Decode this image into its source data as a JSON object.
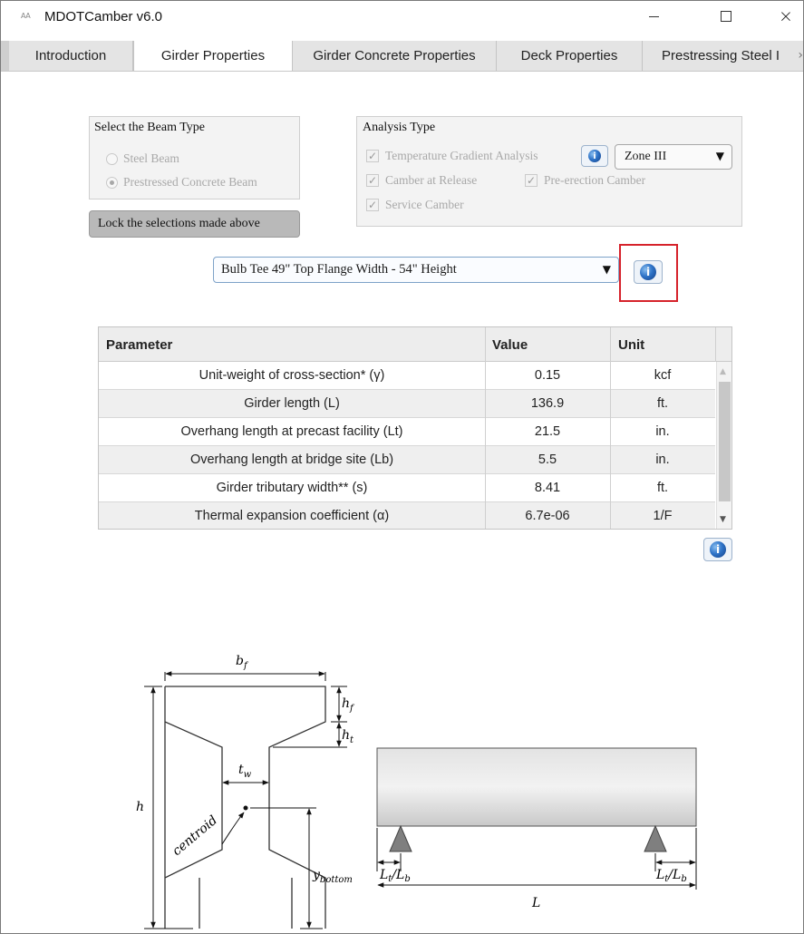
{
  "window": {
    "icon_text": "AA",
    "title": "MDOTCamber v6.0",
    "controls": {
      "minimize": "",
      "maximize": "",
      "close": "×"
    }
  },
  "tabs": [
    {
      "label": "Introduction",
      "active": false
    },
    {
      "label": "Girder Properties",
      "active": true
    },
    {
      "label": "Girder Concrete Properties",
      "active": false
    },
    {
      "label": "Deck Properties",
      "active": false
    },
    {
      "label": "Prestressing Steel I",
      "active": false
    }
  ],
  "beam_type": {
    "title": "Select the Beam Type",
    "options": [
      {
        "label": "Steel Beam",
        "selected": false
      },
      {
        "label": "Prestressed Concrete Beam",
        "selected": true
      }
    ]
  },
  "analysis_type": {
    "title": "Analysis Type",
    "temperature_gradient": {
      "label": "Temperature Gradient Analysis",
      "checked": true
    },
    "zone": {
      "value": "Zone III"
    },
    "camber_at_release": {
      "label": "Camber at Release",
      "checked": true
    },
    "pre_erection": {
      "label": "Pre-erection Camber",
      "checked": true
    },
    "service": {
      "label": "Service Camber",
      "checked": true
    }
  },
  "lock_button": {
    "label": "Lock the selections made above"
  },
  "girder_section": {
    "value": "Bulb Tee 49\" Top Flange Width - 54\" Height"
  },
  "table": {
    "headers": {
      "parameter": "Parameter",
      "value": "Value",
      "unit": "Unit"
    },
    "rows": [
      {
        "parameter": "Unit-weight of cross-section* (γ)",
        "value": "0.15",
        "unit": "kcf"
      },
      {
        "parameter": "Girder length (L)",
        "value": "136.9",
        "unit": "ft."
      },
      {
        "parameter": "Overhang length at precast facility (Lt)",
        "value": "21.5",
        "unit": "in."
      },
      {
        "parameter": "Overhang length at bridge site (Lb)",
        "value": "5.5",
        "unit": "in."
      },
      {
        "parameter": "Girder tributary width** (s)",
        "value": "8.41",
        "unit": "ft."
      },
      {
        "parameter": "Thermal expansion coefficient (α)",
        "value": "6.7e-06",
        "unit": "1/F"
      }
    ]
  },
  "cross_section_labels": {
    "bf": "b",
    "bf_sub": "f",
    "hf": "h",
    "hf_sub": "f",
    "ht": "h",
    "ht_sub": "t",
    "tw": "t",
    "tw_sub": "w",
    "h": "h",
    "centroid": "centroid",
    "ybottom": "y",
    "ybottom_sub": "bottom"
  },
  "elevation_labels": {
    "overhang_left": "L",
    "overhang_left_sub1": "t",
    "overhang_left_mid": "/L",
    "overhang_left_sub2": "b",
    "overhang_right": "L",
    "overhang_right_sub1": "t",
    "overhang_right_mid": "/L",
    "overhang_right_sub2": "b",
    "span": "L"
  },
  "colors": {
    "highlight": "#d6222b",
    "info_blue": "#2f74c8",
    "groupbox_bg": "#f3f3f3",
    "support": "#7f7f7f"
  }
}
